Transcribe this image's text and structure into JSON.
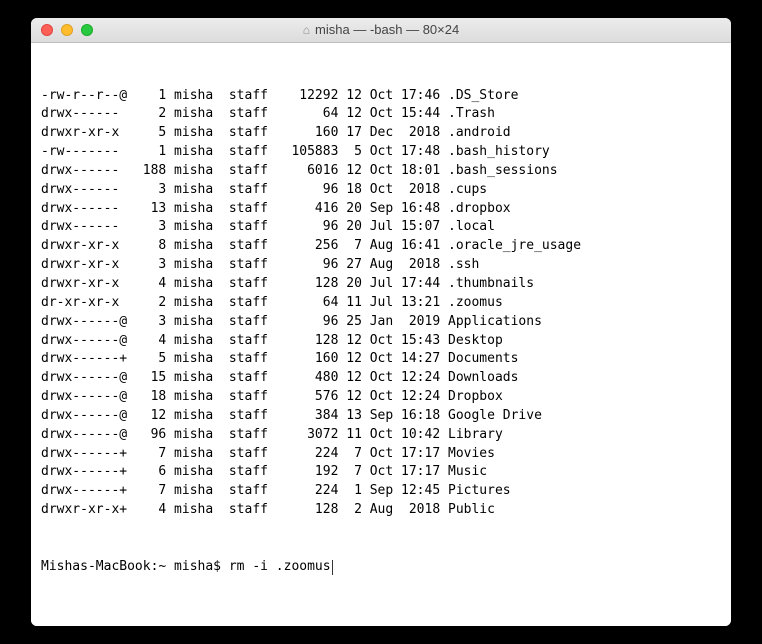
{
  "window": {
    "title": "misha — -bash — 80×24"
  },
  "listing": [
    {
      "perms": "-rw-r--r--@",
      "links": "1",
      "owner": "misha",
      "group": "staff",
      "size": "12292",
      "date": "12 Oct 17:46",
      "name": ".DS_Store"
    },
    {
      "perms": "drwx------",
      "links": "2",
      "owner": "misha",
      "group": "staff",
      "size": "64",
      "date": "12 Oct 15:44",
      "name": ".Trash"
    },
    {
      "perms": "drwxr-xr-x",
      "links": "5",
      "owner": "misha",
      "group": "staff",
      "size": "160",
      "date": "17 Dec  2018",
      "name": ".android"
    },
    {
      "perms": "-rw-------",
      "links": "1",
      "owner": "misha",
      "group": "staff",
      "size": "105883",
      "date": " 5 Oct 17:48",
      "name": ".bash_history"
    },
    {
      "perms": "drwx------",
      "links": "188",
      "owner": "misha",
      "group": "staff",
      "size": "6016",
      "date": "12 Oct 18:01",
      "name": ".bash_sessions"
    },
    {
      "perms": "drwx------",
      "links": "3",
      "owner": "misha",
      "group": "staff",
      "size": "96",
      "date": "18 Oct  2018",
      "name": ".cups"
    },
    {
      "perms": "drwx------",
      "links": "13",
      "owner": "misha",
      "group": "staff",
      "size": "416",
      "date": "20 Sep 16:48",
      "name": ".dropbox"
    },
    {
      "perms": "drwx------",
      "links": "3",
      "owner": "misha",
      "group": "staff",
      "size": "96",
      "date": "20 Jul 15:07",
      "name": ".local"
    },
    {
      "perms": "drwxr-xr-x",
      "links": "8",
      "owner": "misha",
      "group": "staff",
      "size": "256",
      "date": " 7 Aug 16:41",
      "name": ".oracle_jre_usage"
    },
    {
      "perms": "drwxr-xr-x",
      "links": "3",
      "owner": "misha",
      "group": "staff",
      "size": "96",
      "date": "27 Aug  2018",
      "name": ".ssh"
    },
    {
      "perms": "drwxr-xr-x",
      "links": "4",
      "owner": "misha",
      "group": "staff",
      "size": "128",
      "date": "20 Jul 17:44",
      "name": ".thumbnails"
    },
    {
      "perms": "dr-xr-xr-x",
      "links": "2",
      "owner": "misha",
      "group": "staff",
      "size": "64",
      "date": "11 Jul 13:21",
      "name": ".zoomus"
    },
    {
      "perms": "drwx------@",
      "links": "3",
      "owner": "misha",
      "group": "staff",
      "size": "96",
      "date": "25 Jan  2019",
      "name": "Applications"
    },
    {
      "perms": "drwx------@",
      "links": "4",
      "owner": "misha",
      "group": "staff",
      "size": "128",
      "date": "12 Oct 15:43",
      "name": "Desktop"
    },
    {
      "perms": "drwx------+",
      "links": "5",
      "owner": "misha",
      "group": "staff",
      "size": "160",
      "date": "12 Oct 14:27",
      "name": "Documents"
    },
    {
      "perms": "drwx------@",
      "links": "15",
      "owner": "misha",
      "group": "staff",
      "size": "480",
      "date": "12 Oct 12:24",
      "name": "Downloads"
    },
    {
      "perms": "drwx------@",
      "links": "18",
      "owner": "misha",
      "group": "staff",
      "size": "576",
      "date": "12 Oct 12:24",
      "name": "Dropbox"
    },
    {
      "perms": "drwx------@",
      "links": "12",
      "owner": "misha",
      "group": "staff",
      "size": "384",
      "date": "13 Sep 16:18",
      "name": "Google Drive"
    },
    {
      "perms": "drwx------@",
      "links": "96",
      "owner": "misha",
      "group": "staff",
      "size": "3072",
      "date": "11 Oct 10:42",
      "name": "Library"
    },
    {
      "perms": "drwx------+",
      "links": "7",
      "owner": "misha",
      "group": "staff",
      "size": "224",
      "date": " 7 Oct 17:17",
      "name": "Movies"
    },
    {
      "perms": "drwx------+",
      "links": "6",
      "owner": "misha",
      "group": "staff",
      "size": "192",
      "date": " 7 Oct 17:17",
      "name": "Music"
    },
    {
      "perms": "drwx------+",
      "links": "7",
      "owner": "misha",
      "group": "staff",
      "size": "224",
      "date": " 1 Sep 12:45",
      "name": "Pictures"
    },
    {
      "perms": "drwxr-xr-x+",
      "links": "4",
      "owner": "misha",
      "group": "staff",
      "size": "128",
      "date": " 2 Aug  2018",
      "name": "Public"
    }
  ],
  "prompt": {
    "prefix": "Mishas-MacBook:~ misha$ ",
    "command": "rm -i .zoomus"
  }
}
